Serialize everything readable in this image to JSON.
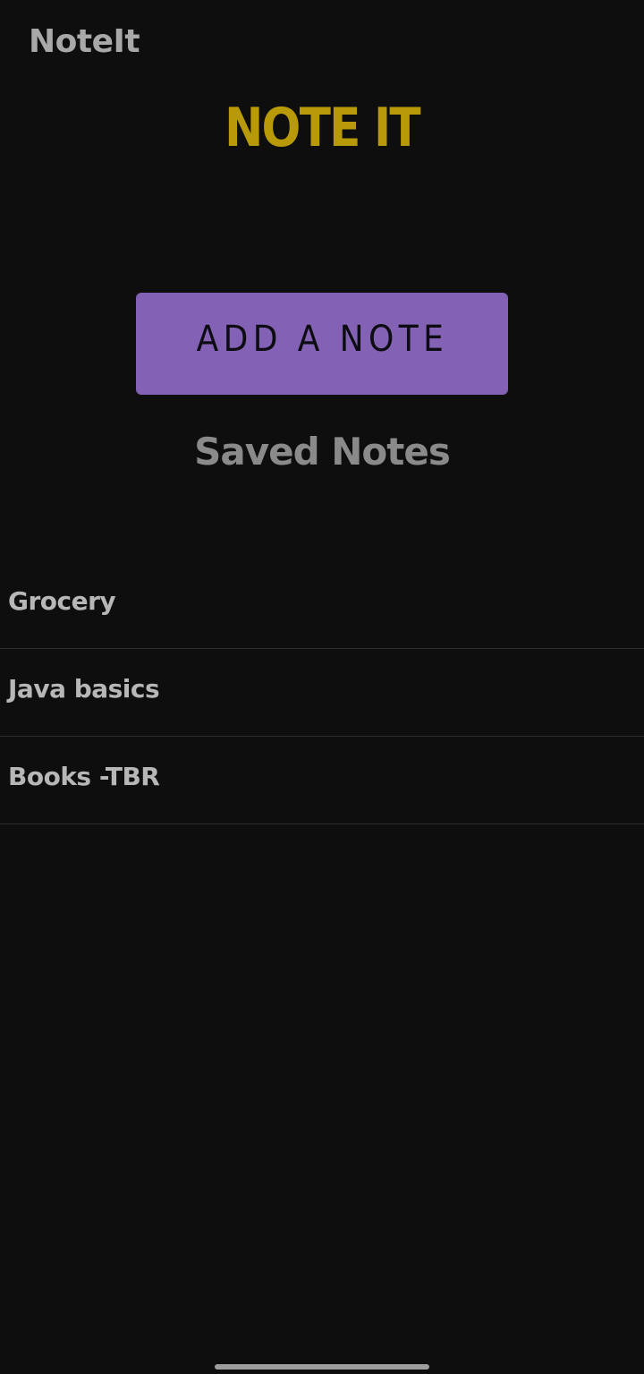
{
  "app_bar": {
    "title": "NoteIt"
  },
  "hero": {
    "title": "NOTE IT"
  },
  "add_button": {
    "label": "ADD A NOTE"
  },
  "saved_notes": {
    "heading": "Saved Notes",
    "items": [
      {
        "label": "Grocery"
      },
      {
        "label": "Java basics"
      },
      {
        "label": "Books -TBR"
      }
    ]
  },
  "colors": {
    "background": "#0e0e0e",
    "accent_yellow": "#b89a08",
    "button_purple": "#8361b4",
    "text_grey": "#b7b7b7",
    "divider": "#2e2e2e"
  }
}
